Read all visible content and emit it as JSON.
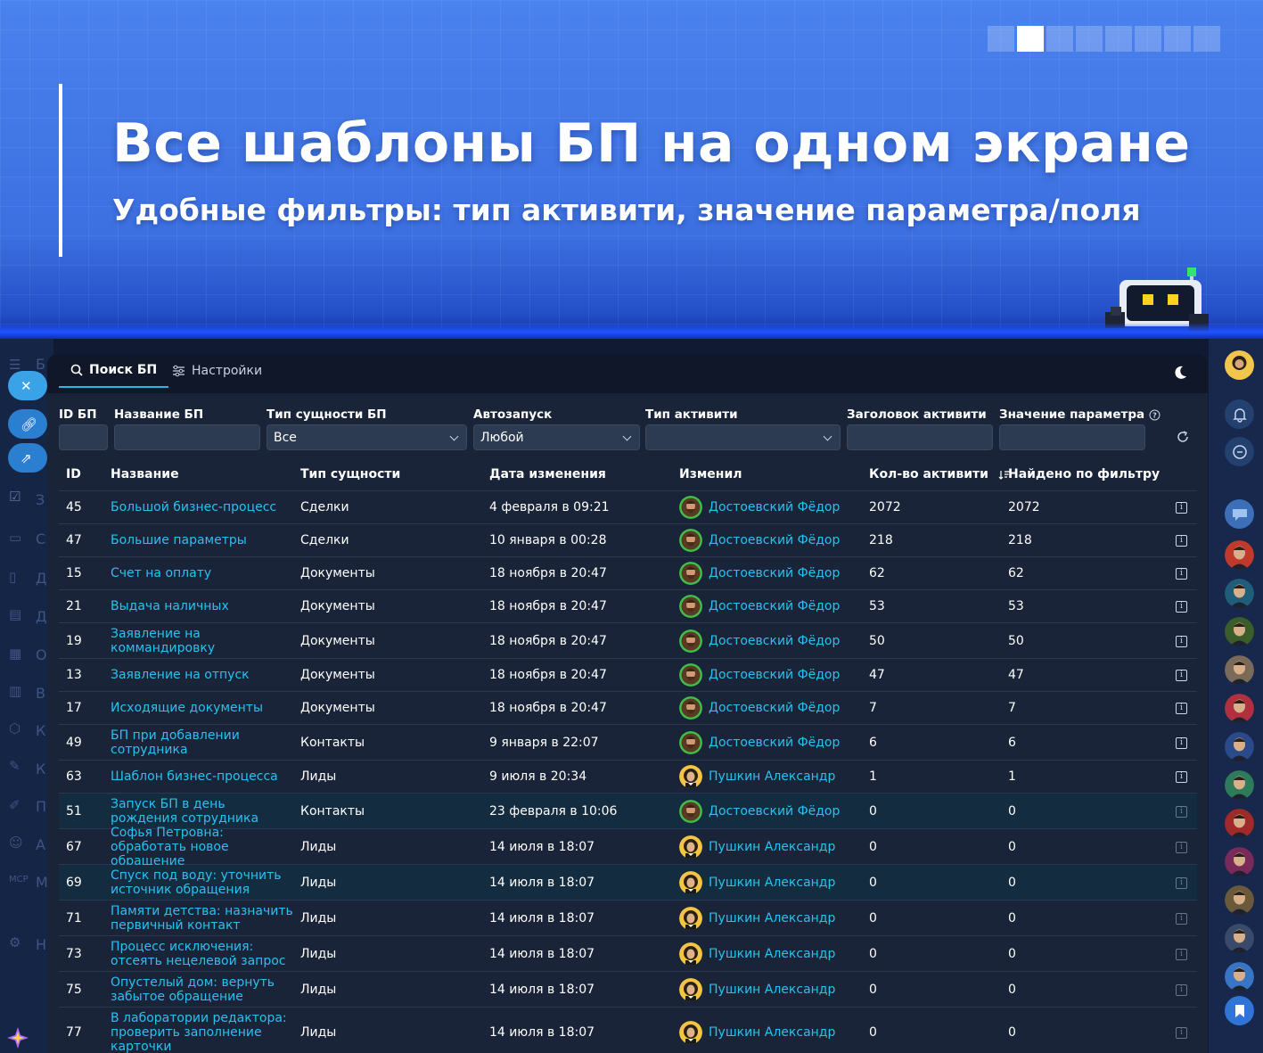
{
  "banner": {
    "title": "Все шаблоны БП на одном экране",
    "subtitle": "Удобные фильтры: тип активити, значение параметра/поля",
    "pager_count": 8,
    "pager_active": 2
  },
  "left_rail": {
    "labels": [
      "Б",
      "З",
      "С",
      "Д",
      "Д",
      "О",
      "В",
      "К",
      "К",
      "П",
      "А",
      "М",
      "Н"
    ]
  },
  "tabs": [
    {
      "label": "Поиск БП",
      "icon": "search-icon",
      "active": true
    },
    {
      "label": "Настройки",
      "icon": "sliders-icon",
      "active": false
    }
  ],
  "filters": {
    "id": {
      "label": "ID БП",
      "value": ""
    },
    "name": {
      "label": "Название БП",
      "value": ""
    },
    "entity_type": {
      "label": "Тип сущности БП",
      "value": "Все"
    },
    "autostart": {
      "label": "Автозапуск",
      "value": "Любой"
    },
    "activity_type": {
      "label": "Тип активити",
      "value": ""
    },
    "activity_title": {
      "label": "Заголовок активити",
      "value": ""
    },
    "param_value": {
      "label": "Значение параметра",
      "value": ""
    }
  },
  "table": {
    "columns": [
      "ID",
      "Название",
      "Тип сущности",
      "Дата изменения",
      "Изменил",
      "Кол-во активити",
      "Найдено по фильтру"
    ],
    "rows": [
      {
        "id": "45",
        "name": "Большой бизнес-процесс",
        "type": "Сделки",
        "date": "4 февраля в 09:21",
        "user": "Достоевский Фёдор",
        "count": "2072",
        "found": "2072"
      },
      {
        "id": "47",
        "name": "Большие параметры",
        "type": "Сделки",
        "date": "10 января в 00:28",
        "user": "Достоевский Фёдор",
        "count": "218",
        "found": "218"
      },
      {
        "id": "15",
        "name": "Счет на оплату",
        "type": "Документы",
        "date": "18 ноября в 20:47",
        "user": "Достоевский Фёдор",
        "count": "62",
        "found": "62"
      },
      {
        "id": "21",
        "name": "Выдача наличных",
        "type": "Документы",
        "date": "18 ноября в 20:47",
        "user": "Достоевский Фёдор",
        "count": "53",
        "found": "53"
      },
      {
        "id": "19",
        "name": "Заявление на коммандировку",
        "type": "Документы",
        "date": "18 ноября в 20:47",
        "user": "Достоевский Фёдор",
        "count": "50",
        "found": "50"
      },
      {
        "id": "13",
        "name": "Заявление на отпуск",
        "type": "Документы",
        "date": "18 ноября в 20:47",
        "user": "Достоевский Фёдор",
        "count": "47",
        "found": "47"
      },
      {
        "id": "17",
        "name": "Исходящие документы",
        "type": "Документы",
        "date": "18 ноября в 20:47",
        "user": "Достоевский Фёдор",
        "count": "7",
        "found": "7"
      },
      {
        "id": "49",
        "name": "БП при добавлении сотрудника",
        "type": "Контакты",
        "date": "9 января в 22:07",
        "user": "Достоевский Фёдор",
        "count": "6",
        "found": "6"
      },
      {
        "id": "63",
        "name": "Шаблон бизнес-процесса",
        "type": "Лиды",
        "date": "9 июля в 20:34",
        "user": "Пушкин Александр",
        "count": "1",
        "found": "1"
      },
      {
        "id": "51",
        "name": "Запуск БП в день рождения сотрудника",
        "type": "Контакты",
        "date": "23 февраля в 10:06",
        "user": "Достоевский Фёдор",
        "count": "0",
        "found": "0"
      },
      {
        "id": "67",
        "name": "Софья Петровна: обработать новое обращение",
        "type": "Лиды",
        "date": "14 июля в 18:07",
        "user": "Пушкин Александр",
        "count": "0",
        "found": "0"
      },
      {
        "id": "69",
        "name": "Спуск под воду: уточнить источник обращения",
        "type": "Лиды",
        "date": "14 июля в 18:07",
        "user": "Пушкин Александр",
        "count": "0",
        "found": "0"
      },
      {
        "id": "71",
        "name": "Памяти детства: назначить первичный контакт",
        "type": "Лиды",
        "date": "14 июля в 18:07",
        "user": "Пушкин Александр",
        "count": "0",
        "found": "0"
      },
      {
        "id": "73",
        "name": "Процесс исключения: отсеять нецелевой запрос",
        "type": "Лиды",
        "date": "14 июля в 18:07",
        "user": "Пушкин Александр",
        "count": "0",
        "found": "0"
      },
      {
        "id": "75",
        "name": "Опустелый дом: вернуть забытое обращение",
        "type": "Лиды",
        "date": "14 июля в 18:07",
        "user": "Пушкин Александр",
        "count": "0",
        "found": "0"
      },
      {
        "id": "77",
        "name": "В лаборатории редактора: проверить заполнение карточки",
        "type": "Лиды",
        "date": "14 июля в 18:07",
        "user": "Пушкин Александр",
        "count": "0",
        "found": "0"
      }
    ]
  },
  "colors": {
    "banner": "#3f73e3",
    "panel": "#1a2438",
    "link": "#29c1f0",
    "tab_underline": "#2fb3e8"
  }
}
